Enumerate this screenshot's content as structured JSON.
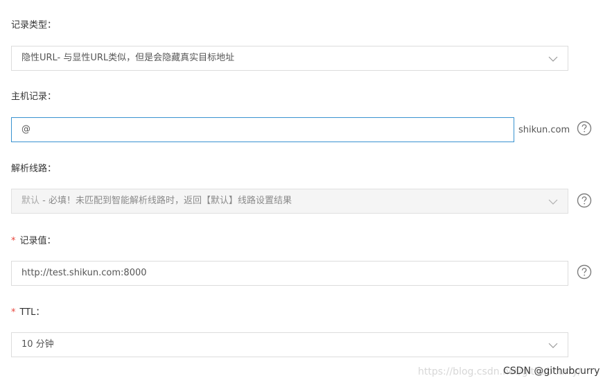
{
  "record_type": {
    "label": "记录类型：",
    "value": "隐性URL- 与显性URL类似，但是会隐藏真实目标地址",
    "icon": "chevron-down-icon"
  },
  "host_record": {
    "label": "主机记录：",
    "value": "@",
    "suffix": "shikun.com",
    "help_icon": "question-circle-icon"
  },
  "resolution_line": {
    "label": "解析线路：",
    "value_prefix": "默认",
    "value_rest": " - 必填！未匹配到智能解析线路时，返回【默认】线路设置结果",
    "icon": "chevron-down-icon",
    "help_icon": "question-circle-icon"
  },
  "record_value": {
    "required_mark": "*",
    "label": "记录值：",
    "value": "http://test.shikun.com:8000",
    "help_icon": "question-circle-icon"
  },
  "ttl": {
    "required_mark": "*",
    "label": "TTL：",
    "value": "10 分钟",
    "icon": "chevron-down-icon"
  },
  "watermark": {
    "url": "https://blog.csdn.net/githubcurry/",
    "csdn": "CSDN @githubcurry"
  },
  "colors": {
    "focus_border": "#3892d0",
    "required": "#e8453c",
    "border": "#dcdcdc",
    "disabled_bg": "#f5f5f5"
  }
}
